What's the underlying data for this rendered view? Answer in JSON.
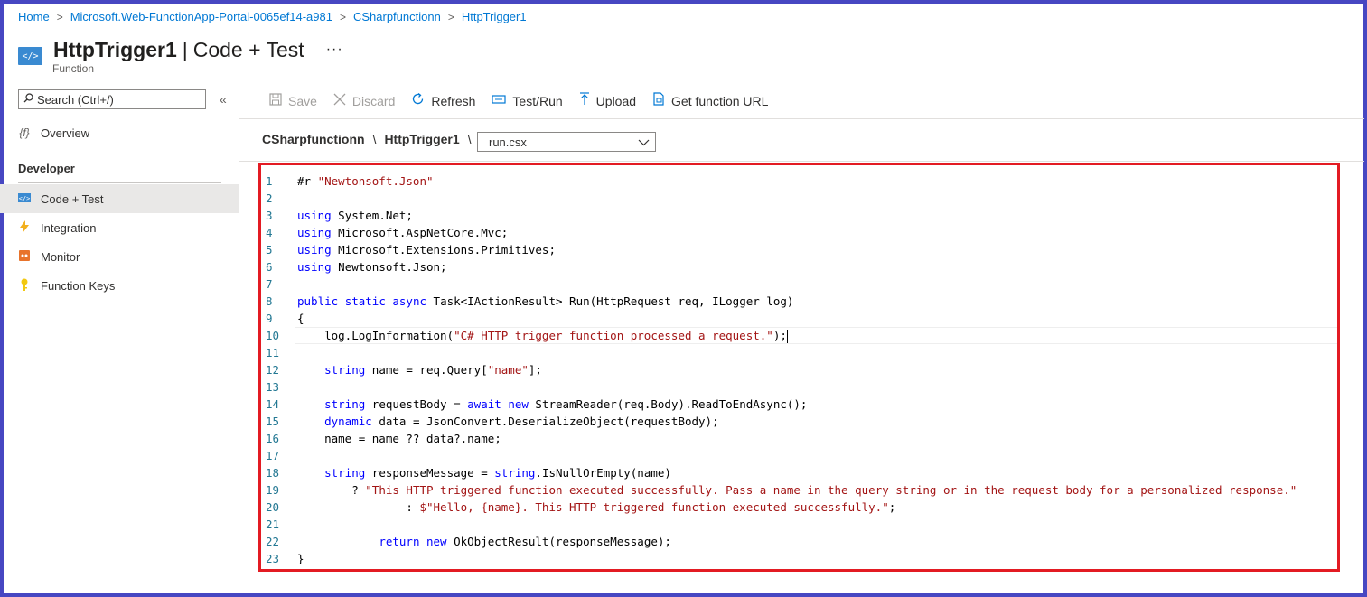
{
  "breadcrumb": {
    "items": [
      "Home",
      "Microsoft.Web-FunctionApp-Portal-0065ef14-a981",
      "CSharpfunctionn",
      "HttpTrigger1"
    ]
  },
  "header": {
    "title": "HttpTrigger1",
    "subtitle_part": "Code + Test",
    "type_label": "Function",
    "more": "···"
  },
  "sidebar": {
    "search_placeholder": "Search (Ctrl+/)",
    "collapse": "«",
    "overview": "Overview",
    "section": "Developer",
    "items": [
      "Code + Test",
      "Integration",
      "Monitor",
      "Function Keys"
    ]
  },
  "toolbar": {
    "save": "Save",
    "discard": "Discard",
    "refresh": "Refresh",
    "testrun": "Test/Run",
    "upload": "Upload",
    "get_url": "Get function URL"
  },
  "path": {
    "app": "CSharpfunctionn",
    "fn": "HttpTrigger1",
    "file": "run.csx"
  },
  "editor": {
    "lines": [
      "#r \"Newtonsoft.Json\"",
      "",
      "using System.Net;",
      "using Microsoft.AspNetCore.Mvc;",
      "using Microsoft.Extensions.Primitives;",
      "using Newtonsoft.Json;",
      "",
      "public static async Task<IActionResult> Run(HttpRequest req, ILogger log)",
      "{",
      "    log.LogInformation(\"C# HTTP trigger function processed a request.\");",
      "",
      "    string name = req.Query[\"name\"];",
      "",
      "    string requestBody = await new StreamReader(req.Body).ReadToEndAsync();",
      "    dynamic data = JsonConvert.DeserializeObject(requestBody);",
      "    name = name ?? data?.name;",
      "",
      "    string responseMessage = string.IsNullOrEmpty(name)",
      "        ? \"This HTTP triggered function executed successfully. Pass a name in the query string or in the request body for a personalized response.\"",
      "                : $\"Hello, {name}. This HTTP triggered function executed successfully.\";",
      "",
      "            return new OkObjectResult(responseMessage);",
      "}"
    ],
    "cursor_line": 10
  },
  "colors": {
    "accent": "#0078d4",
    "frame": "#4747c2",
    "highlight": "#e31b23",
    "keyword": "#0000ff",
    "string": "#a31515",
    "line_number": "#237893"
  }
}
